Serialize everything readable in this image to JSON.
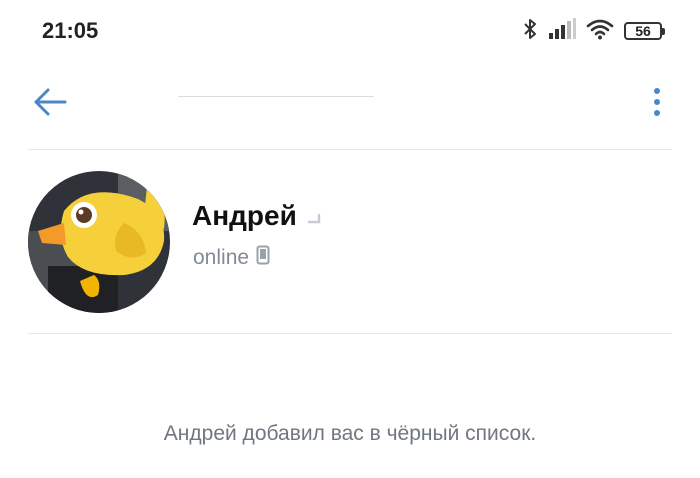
{
  "status_bar": {
    "time": "21:05",
    "battery_level": "56",
    "icons": [
      "bluetooth-icon",
      "signal-icon",
      "wifi-icon",
      "battery-icon"
    ]
  },
  "nav": {
    "back_icon": "arrow-left-icon",
    "menu_icon": "more-vertical-icon",
    "accent_color": "#4a86c8"
  },
  "profile": {
    "name": "Андрей",
    "status": "online",
    "status_icon": "mobile-phone-icon"
  },
  "message": {
    "blacklist_text": "Андрей добавил вас в чёрный список."
  }
}
